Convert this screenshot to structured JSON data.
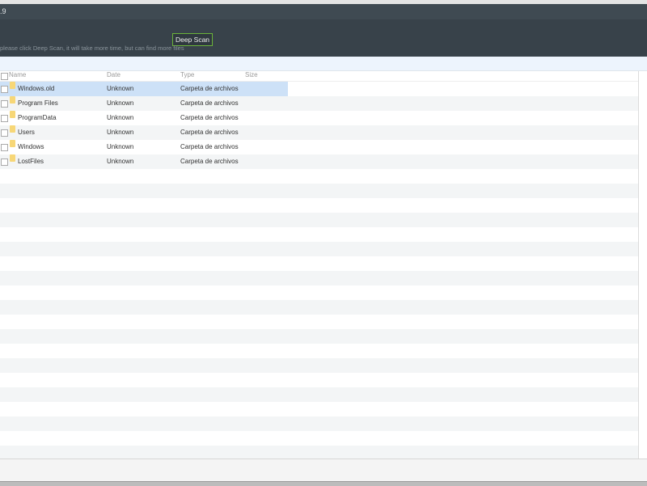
{
  "window": {
    "title": ".9"
  },
  "toolbar": {
    "deep_scan_label": "Deep Scan",
    "hint": "please click Deep Scan, it will take more time, but can find more files"
  },
  "table": {
    "columns": [
      "Name",
      "Date",
      "Type",
      "Size"
    ],
    "rows": [
      {
        "name": "Windows.old",
        "date": "Unknown",
        "type": "Carpeta de archivos",
        "size": "",
        "selected": true
      },
      {
        "name": "Program Files",
        "date": "Unknown",
        "type": "Carpeta de archivos",
        "size": ""
      },
      {
        "name": "ProgramData",
        "date": "Unknown",
        "type": "Carpeta de archivos",
        "size": ""
      },
      {
        "name": "Users",
        "date": "Unknown",
        "type": "Carpeta de archivos",
        "size": ""
      },
      {
        "name": "Windows",
        "date": "Unknown",
        "type": "Carpeta de archivos",
        "size": ""
      },
      {
        "name": "LostFiles",
        "date": "Unknown",
        "type": "Carpeta de archivos",
        "size": ""
      }
    ]
  },
  "colors": {
    "accent": "#6bb33a",
    "toolbar": "#38424a",
    "selected": "#cde1f7"
  }
}
